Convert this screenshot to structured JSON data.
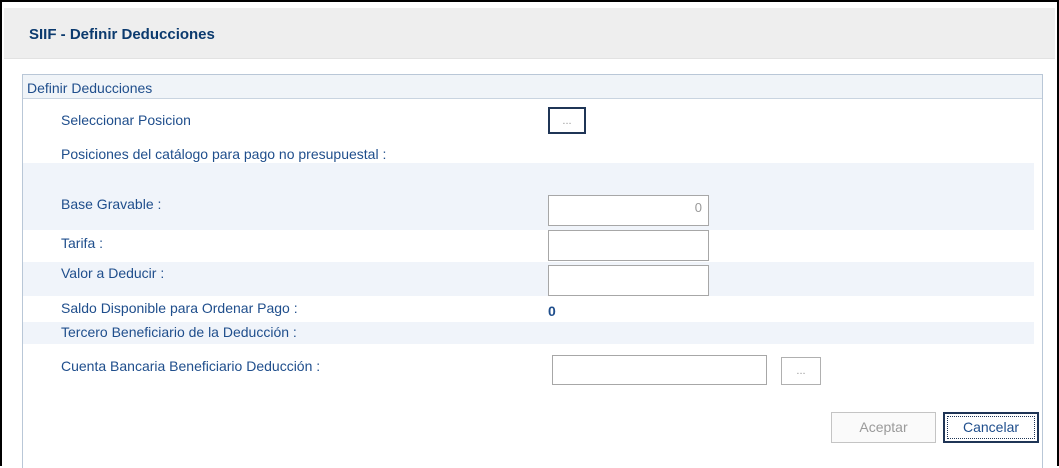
{
  "window": {
    "title": "SIIF - Definir Deducciones"
  },
  "panel": {
    "header": "Definir Deducciones",
    "seleccionar_posicion": {
      "label": "Seleccionar Posicion",
      "button": "..."
    },
    "posiciones_label": "Posiciones del catálogo para pago no presupuestal :",
    "base_gravable": {
      "label": "Base Gravable :",
      "value": "0"
    },
    "tarifa": {
      "label": "Tarifa :",
      "value": ""
    },
    "valor_deducir": {
      "label": "Valor a Deducir :",
      "value": ""
    },
    "saldo_disponible": {
      "label": "Saldo Disponible para Ordenar Pago :",
      "value": "0"
    },
    "tercero_beneficiario": {
      "label": "Tercero Beneficiario de la Deducción :"
    },
    "cuenta_bancaria": {
      "label": "Cuenta Bancaria Beneficiario Deducción :",
      "value": "",
      "button": "..."
    }
  },
  "buttons": {
    "aceptar": "Aceptar",
    "cancelar": "Cancelar"
  }
}
